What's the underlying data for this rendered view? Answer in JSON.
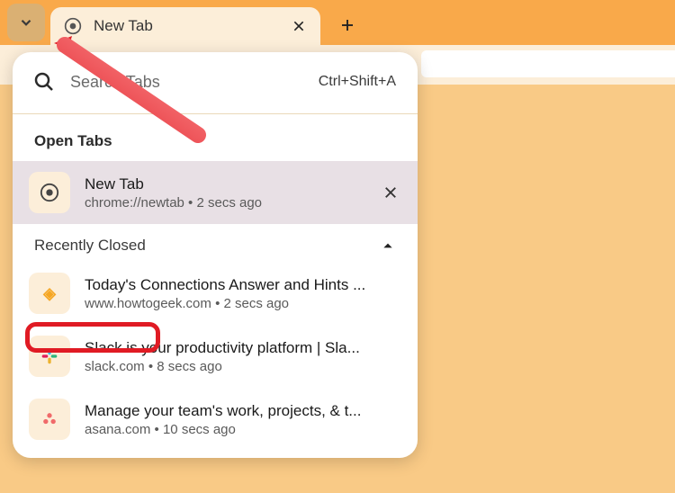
{
  "tab_strip": {
    "dropdown_icon": "chevron-down",
    "tabs": [
      {
        "title": "New Tab",
        "favicon": "chrome"
      }
    ],
    "new_tab_button": "plus"
  },
  "panel": {
    "search": {
      "placeholder": "Search Tabs",
      "shortcut": "Ctrl+Shift+A"
    },
    "open_tabs_label": "Open Tabs",
    "open_tabs": [
      {
        "title": "New Tab",
        "subtitle": "chrome://newtab  •  2 secs ago",
        "favicon": "chrome",
        "active": true
      }
    ],
    "recently_closed_label": "Recently Closed",
    "recently_closed_collapsed": false,
    "recently_closed": [
      {
        "title": "Today's Connections Answer and Hints ...",
        "subtitle": "www.howtogeek.com  •  2 secs ago",
        "favicon": "howtogeek"
      },
      {
        "title": "Slack is your productivity platform | Sla...",
        "subtitle": "slack.com  •  8 secs ago",
        "favicon": "slack"
      },
      {
        "title": "Manage your team's work, projects, & t...",
        "subtitle": "asana.com  •  10 secs ago",
        "favicon": "asana"
      }
    ]
  },
  "annotations": {
    "highlight_target": "recently-closed-header",
    "arrow_target": "tab-search-button"
  }
}
